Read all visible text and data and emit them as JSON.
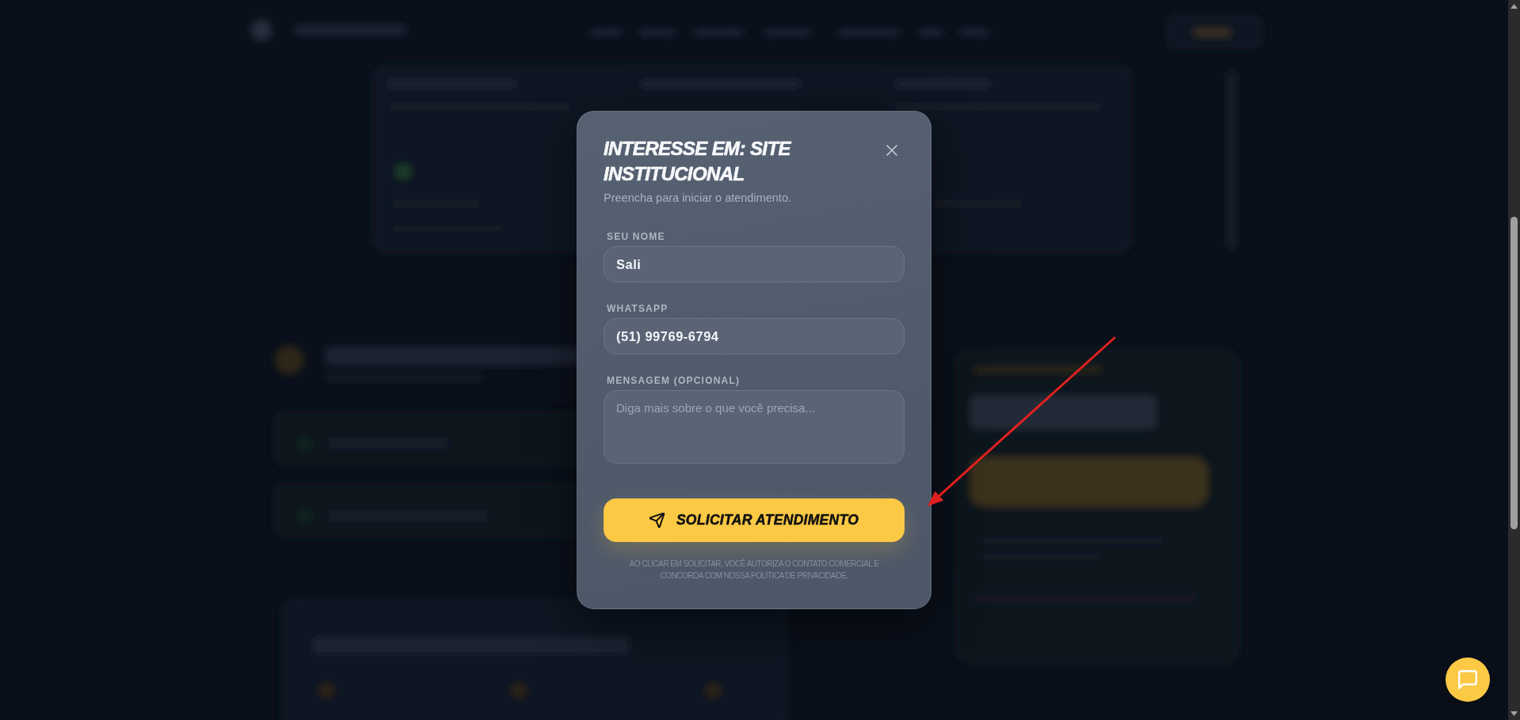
{
  "modal": {
    "title": "INTERESSE EM: SITE INSTITUCIONAL",
    "subtitle": "Preencha para iniciar o atendimento.",
    "fields": [
      {
        "kind": "input",
        "label": "SEU NOME",
        "value": "Sali"
      },
      {
        "kind": "input",
        "label": "WHATSAPP",
        "value": "(51) 99769-6794"
      },
      {
        "kind": "textarea",
        "label": "MENSAGEM (OPCIONAL)",
        "placeholder": "Diga mais sobre o que você precisa..."
      }
    ],
    "submit_button": {
      "label": "SOLICITAR ATENDIMENTO"
    },
    "disclaimer": "AO CLICAR EM SOLICITAR, VOCÊ AUTORIZA O CONTATO COMERCIAL E CONCORDA COM NOSSA POLÍTICA DE PRIVACIDADE."
  }
}
